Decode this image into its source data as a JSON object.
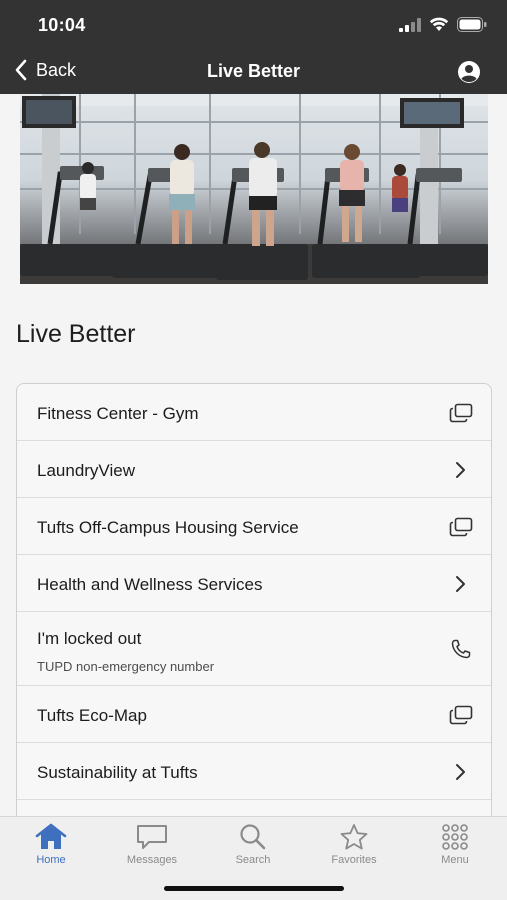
{
  "status_bar": {
    "time": "10:04"
  },
  "nav": {
    "back_label": "Back",
    "title": "Live Better"
  },
  "section": {
    "title": "Live Better"
  },
  "list": [
    {
      "title": "Fitness Center - Gym",
      "subtitle": "",
      "icon": "external-link-icon"
    },
    {
      "title": "LaundryView",
      "subtitle": "",
      "icon": "chevron-right-icon"
    },
    {
      "title": "Tufts Off-Campus Housing Service",
      "subtitle": "",
      "icon": "external-link-icon"
    },
    {
      "title": "Health and Wellness Services",
      "subtitle": "",
      "icon": "chevron-right-icon"
    },
    {
      "title": "I'm locked out",
      "subtitle": "TUPD non-emergency number",
      "icon": "phone-icon"
    },
    {
      "title": "Tufts Eco-Map",
      "subtitle": "",
      "icon": "external-link-icon"
    },
    {
      "title": "Sustainability at Tufts",
      "subtitle": "",
      "icon": "chevron-right-icon"
    }
  ],
  "tabs": [
    {
      "label": "Home",
      "icon": "home-icon",
      "active": true
    },
    {
      "label": "Messages",
      "icon": "message-icon",
      "active": false
    },
    {
      "label": "Search",
      "icon": "search-icon",
      "active": false
    },
    {
      "label": "Favorites",
      "icon": "star-icon",
      "active": false
    },
    {
      "label": "Menu",
      "icon": "grid-icon",
      "active": false
    }
  ],
  "colors": {
    "header": "#333333",
    "accent": "#3f6fbf",
    "tab_inactive": "#8a8a8a"
  }
}
